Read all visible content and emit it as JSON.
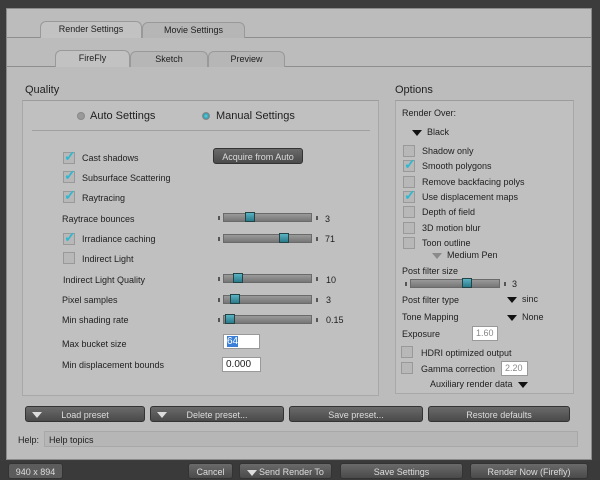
{
  "tabs": [
    {
      "label": "Render Settings",
      "active": true
    },
    {
      "label": "Movie Settings",
      "active": false
    }
  ],
  "subtabs": [
    {
      "label": "FireFly",
      "active": true
    },
    {
      "label": "Sketch",
      "active": false
    },
    {
      "label": "Preview",
      "active": false
    }
  ],
  "quality": {
    "title": "Quality",
    "mode_options": [
      {
        "label": "Auto Settings",
        "selected": false
      },
      {
        "label": "Manual Settings",
        "selected": true
      }
    ],
    "acquire_button": "Acquire from Auto",
    "cast_shadows": {
      "label": "Cast shadows",
      "checked": true
    },
    "subsurface": {
      "label": "Subsurface Scattering",
      "checked": true
    },
    "raytracing": {
      "label": "Raytracing",
      "checked": true
    },
    "raytrace_bounces": {
      "label": "Raytrace bounces",
      "value": "3",
      "fraction": 0.28
    },
    "irradiance": {
      "label": "Irradiance caching",
      "checked": true,
      "value": "71",
      "fraction": 0.71
    },
    "indirect_light": {
      "label": "Indirect Light",
      "checked": false
    },
    "indirect_quality": {
      "label": "Indirect Light Quality",
      "value": "10",
      "fraction": 0.13
    },
    "pixel_samples": {
      "label": "Pixel samples",
      "value": "3",
      "fraction": 0.09
    },
    "min_shading": {
      "label": "Min shading rate",
      "value": "0.15",
      "fraction": 0.03
    },
    "max_bucket": {
      "label": "Max bucket size",
      "value": "64"
    },
    "min_disp": {
      "label": "Min displacement bounds",
      "value": "0.000"
    }
  },
  "options": {
    "title": "Options",
    "render_over_label": "Render Over:",
    "render_over_value": "Black",
    "checks": [
      {
        "label": "Shadow only",
        "checked": false
      },
      {
        "label": "Smooth polygons",
        "checked": true
      },
      {
        "label": "Remove backfacing polys",
        "checked": false
      },
      {
        "label": "Use displacement maps",
        "checked": true
      },
      {
        "label": "Depth of field",
        "checked": false
      },
      {
        "label": "3D motion blur",
        "checked": false
      },
      {
        "label": "Toon outline",
        "checked": false
      }
    ],
    "pen": "Medium Pen",
    "post_filter_size": {
      "label": "Post filter size",
      "value": "3",
      "fraction": 0.65
    },
    "post_filter_type": {
      "label": "Post filter type",
      "value": "sinc"
    },
    "tone_mapping": {
      "label": "Tone Mapping",
      "value": "None"
    },
    "exposure": {
      "label": "Exposure",
      "value": "1.60"
    },
    "hdri": {
      "label": "HDRI optimized output",
      "checked": false
    },
    "gamma": {
      "label": "Gamma correction",
      "checked": false,
      "value": "2.20"
    },
    "aux": "Auxiliary render data"
  },
  "presets": {
    "load": "Load preset",
    "delete": "Delete preset...",
    "save": "Save preset...",
    "restore": "Restore defaults"
  },
  "help": {
    "label": "Help:",
    "value": "Help topics"
  },
  "footer": {
    "size": "940 x 894",
    "cancel": "Cancel",
    "send": "Send Render To",
    "save": "Save Settings",
    "render": "Render Now (Firefly)"
  },
  "colors": {
    "accent": "#2fb8d0",
    "panel": "#bcbcbc",
    "button": "#555555"
  }
}
